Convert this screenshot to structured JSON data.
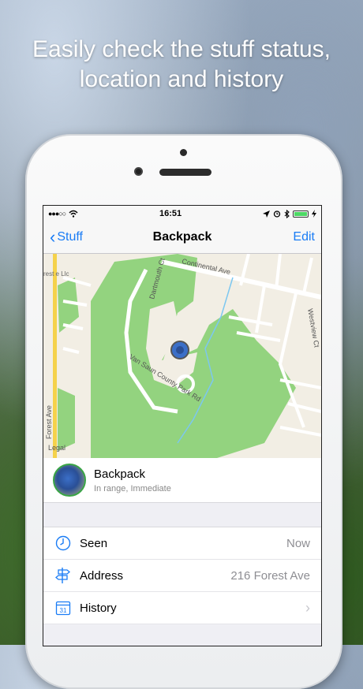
{
  "headline": {
    "line1": "Easily check the stuff status,",
    "line2": "location and history"
  },
  "statusbar": {
    "time": "16:51",
    "icons": [
      "signal-dots-icon",
      "wifi-icon",
      "location-arrow-icon",
      "alarm-icon",
      "bluetooth-icon",
      "battery-icon",
      "charging-icon"
    ]
  },
  "navbar": {
    "back_label": "Stuff",
    "title": "Backpack",
    "edit_label": "Edit"
  },
  "map": {
    "labels": {
      "continental": "Continental Ave",
      "dartmouth": "Dartmouth Ct",
      "westview": "Westview Ct",
      "forest_ave": "Forest Ave",
      "park_rd": "Van Saun County Park Rd",
      "forest_lic": "rest\ne Llc",
      "legal": "Legal"
    },
    "colors": {
      "park": "#93d37f",
      "land": "#f2eee4",
      "road": "#ffffff",
      "highway": "#f5d24b",
      "water": "#7cc7f0"
    }
  },
  "item": {
    "name": "Backpack",
    "status": "In range, Immediate"
  },
  "rows": [
    {
      "icon": "clock-icon",
      "label": "Seen",
      "value": "Now"
    },
    {
      "icon": "signpost-icon",
      "label": "Address",
      "value": "216 Forest Ave"
    },
    {
      "icon": "calendar-icon",
      "label": "History",
      "value": "",
      "calendar_day": "31"
    }
  ],
  "accent": "#1a7cf5"
}
